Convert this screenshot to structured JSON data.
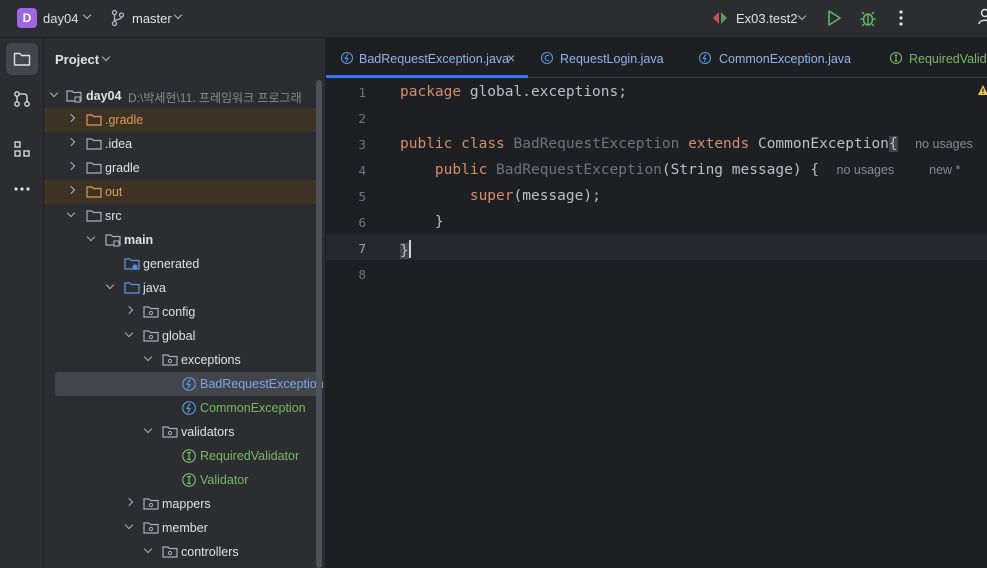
{
  "titlebar": {
    "project_badge": "D",
    "project_name": "day04",
    "branch": "master",
    "run_config": "Ex03.test2"
  },
  "panel": {
    "title": "Project",
    "tree": [
      {
        "label": "day04",
        "hint": "D:\\박세현\\11. 프레임워크 프로그래",
        "bold": true
      },
      {
        "label": ".gradle"
      },
      {
        "label": ".idea"
      },
      {
        "label": "gradle"
      },
      {
        "label": "out"
      },
      {
        "label": "src"
      },
      {
        "label": "main",
        "bold": true
      },
      {
        "label": "generated"
      },
      {
        "label": "java"
      },
      {
        "label": "config"
      },
      {
        "label": "global"
      },
      {
        "label": "exceptions"
      },
      {
        "label": "BadRequestException"
      },
      {
        "label": "CommonException"
      },
      {
        "label": "validators"
      },
      {
        "label": "RequiredValidator"
      },
      {
        "label": "Validator"
      },
      {
        "label": "mappers"
      },
      {
        "label": "member"
      },
      {
        "label": "controllers"
      }
    ]
  },
  "tabs": [
    {
      "label": "BadRequestException.java",
      "active": true
    },
    {
      "label": "RequestLogin.java"
    },
    {
      "label": "CommonException.java"
    },
    {
      "label": "RequiredValid"
    }
  ],
  "editor": {
    "line_numbers": [
      "1",
      "2",
      "3",
      "4",
      "5",
      "6",
      "7",
      "8"
    ],
    "current_line": "7",
    "code": {
      "l1_kw": "package",
      "l1_rest": " global.exceptions;",
      "l3_kw1": "public",
      "l3_kw2": "class",
      "l3_name": "BadRequestException",
      "l3_kw3": "extends",
      "l3_super": "CommonException",
      "l3_brace": "{",
      "l3_hint": "no usages",
      "l4_kw": "public",
      "l4_name": "BadRequestException",
      "l4_params": "(String message) {",
      "l4_hint1": "no usages",
      "l4_hint2": "new *",
      "l5_call": "super",
      "l5_rest": "(message);",
      "l6": "}",
      "l7": "}"
    }
  }
}
